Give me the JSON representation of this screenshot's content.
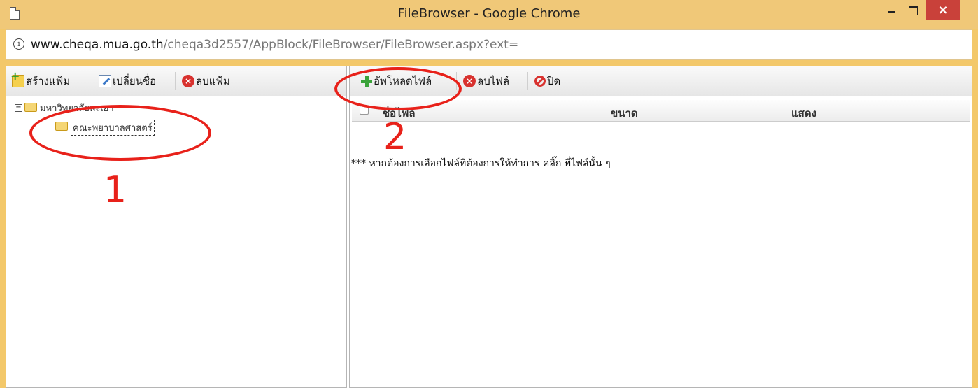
{
  "window": {
    "title": "FileBrowser - Google Chrome",
    "close_glyph": "×"
  },
  "address": {
    "host": "www.cheqa.mua.go.th",
    "path": "/cheqa3d2557/AppBlock/FileBrowser/FileBrowser.aspx?ext="
  },
  "left_toolbar": {
    "create_folder": "สร้างแฟ้ม",
    "rename": "เปลี่ยนชื่อ",
    "delete_folder": "ลบแฟ้ม"
  },
  "tree": {
    "root_label": "มหาวิทยาลัยพะเยา",
    "child_label": "คณะพยาบาลศาสตร์"
  },
  "right_toolbar": {
    "upload": "อัพโหลดไฟล์",
    "delete_file": "ลบไฟล์",
    "close": "ปิด"
  },
  "grid": {
    "columns": [
      "ชื่อไฟล์",
      "ขนาด",
      "แสดง"
    ],
    "hint": "*** หากต้องการเลือกไฟล์ที่ต้องการให้ทำการ คลิ๊ก ที่ไฟล์นั้น ๆ"
  },
  "annotations": {
    "one": "1",
    "two": "2",
    "color": "#e8211a"
  }
}
